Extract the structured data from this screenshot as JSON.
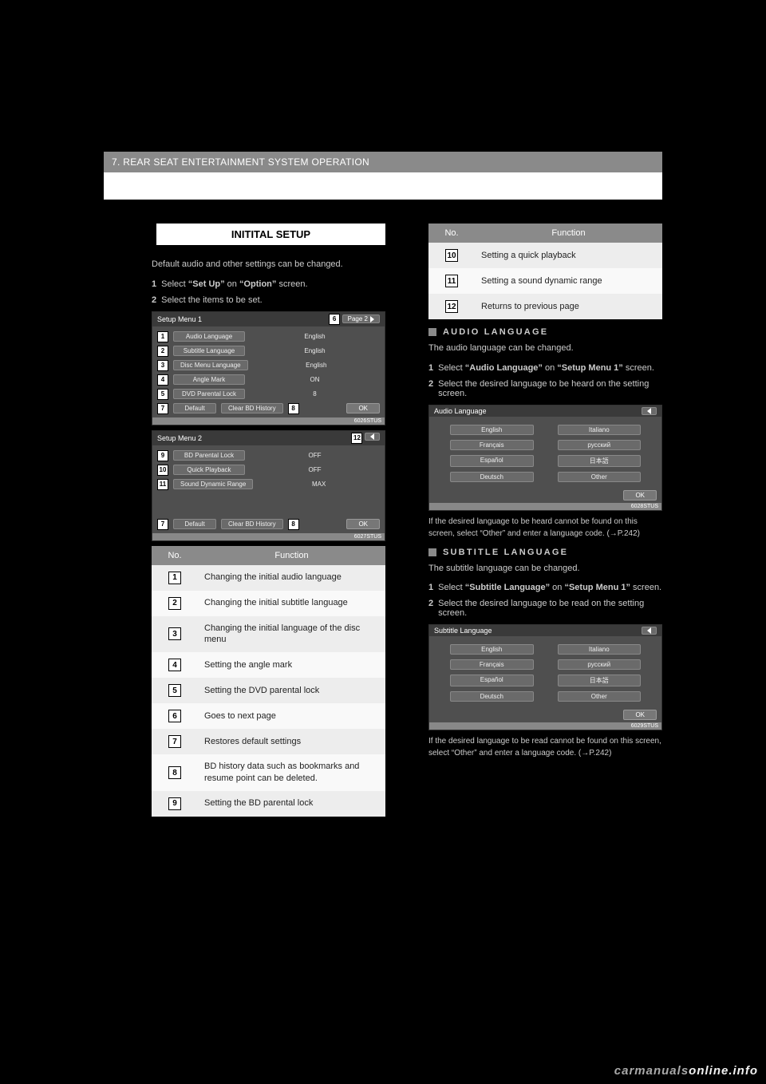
{
  "header": "7. REAR SEAT ENTERTAINMENT SYSTEM OPERATION",
  "section_title": "INITITAL SETUP",
  "intro_text": "Default audio and other settings can be changed.",
  "step1": {
    "num": "1",
    "text_a": "Select ",
    "q1": "“Set Up”",
    "text_b": " on ",
    "q2": "“Option”",
    "text_c": " screen."
  },
  "step2": {
    "num": "2",
    "text": "Select the items to be set."
  },
  "setup_menu1": {
    "title": "Setup Menu 1",
    "page_btn_num": "6",
    "page_btn_lbl": "Page 2",
    "rows": [
      {
        "num": "1",
        "label": "Audio Language",
        "value": "English"
      },
      {
        "num": "2",
        "label": "Subtitle Language",
        "value": "English"
      },
      {
        "num": "3",
        "label": "Disc Menu Language",
        "value": "English"
      },
      {
        "num": "4",
        "label": "Angle Mark",
        "value": "ON"
      },
      {
        "num": "5",
        "label": "DVD Parental Lock",
        "value": "8"
      }
    ],
    "default_num": "7",
    "default_lbl": "Default",
    "clear_lbl": "Clear BD History",
    "clear_num": "8",
    "ok": "OK",
    "tag": "6026STUS"
  },
  "setup_menu2": {
    "title": "Setup Menu 2",
    "back_num": "12",
    "rows": [
      {
        "num": "9",
        "label": "BD Parental Lock",
        "value": "OFF"
      },
      {
        "num": "10",
        "label": "Quick Playback",
        "value": "OFF"
      },
      {
        "num": "11",
        "label": "Sound Dynamic Range",
        "value": "MAX"
      }
    ],
    "default_num": "7",
    "default_lbl": "Default",
    "clear_lbl": "Clear BD History",
    "clear_num": "8",
    "ok": "OK",
    "tag": "6027STUS"
  },
  "fn_table_left": {
    "head_no": "No.",
    "head_fn": "Function",
    "rows": [
      {
        "num": "1",
        "desc": "Changing the initial audio language"
      },
      {
        "num": "2",
        "desc": "Changing the initial subtitle language"
      },
      {
        "num": "3",
        "desc": "Changing the initial language of the disc menu"
      },
      {
        "num": "4",
        "desc": "Setting the angle mark"
      },
      {
        "num": "5",
        "desc": "Setting the DVD parental lock"
      },
      {
        "num": "6",
        "desc": "Goes to next page"
      },
      {
        "num": "7",
        "desc": "Restores default settings"
      },
      {
        "num": "8",
        "desc": "BD history data such as bookmarks and resume point can be deleted."
      },
      {
        "num": "9",
        "desc": "Setting the BD parental lock"
      }
    ]
  },
  "fn_table_right": {
    "head_no": "No.",
    "head_fn": "Function",
    "rows": [
      {
        "num": "10",
        "desc": "Setting a quick playback"
      },
      {
        "num": "11",
        "desc": "Setting a sound dynamic range"
      },
      {
        "num": "12",
        "desc": "Returns to previous page"
      }
    ]
  },
  "audio_lang_heading": "AUDIO LANGUAGE",
  "audio_lang_intro": "The audio language can be changed.",
  "audio_step1": {
    "num": "1",
    "text_a": "Select ",
    "q1": "“Audio Language”",
    "text_b": " on ",
    "q2": "“Setup Menu 1”",
    "text_c": " screen."
  },
  "audio_step2": {
    "num": "2",
    "text": "Select the desired language to be heard on the setting screen."
  },
  "audio_mock": {
    "title": "Audio Language",
    "langs": [
      "English",
      "Italiano",
      "Français",
      "русский",
      "Español",
      "日本語",
      "Deutsch",
      "Other"
    ],
    "ok": "OK",
    "tag": "6028STUS"
  },
  "audio_note": "If the desired language to be heard cannot be found on this screen, select “Other” and enter a language code. (→P.242)",
  "subtitle_heading": "SUBTITLE LANGUAGE",
  "subtitle_intro": "The subtitle language can be changed.",
  "subtitle_step1": {
    "num": "1",
    "text_a": "Select ",
    "q1": "“Subtitle Language”",
    "text_b": " on ",
    "q2": "“Setup Menu 1”",
    "text_c": " screen."
  },
  "subtitle_step2": {
    "num": "2",
    "text": "Select the desired language to be read on the setting screen."
  },
  "subtitle_mock": {
    "title": "Subtitle Language",
    "langs": [
      "English",
      "Italiano",
      "Français",
      "русский",
      "Español",
      "日本語",
      "Deutsch",
      "Other"
    ],
    "ok": "OK",
    "tag": "6029STUS"
  },
  "subtitle_note": "If the desired language to be read cannot be found on this screen, select “Other” and enter a language code. (→P.242)",
  "watermark": {
    "dark": "carmanuals",
    "light": "online.info"
  }
}
